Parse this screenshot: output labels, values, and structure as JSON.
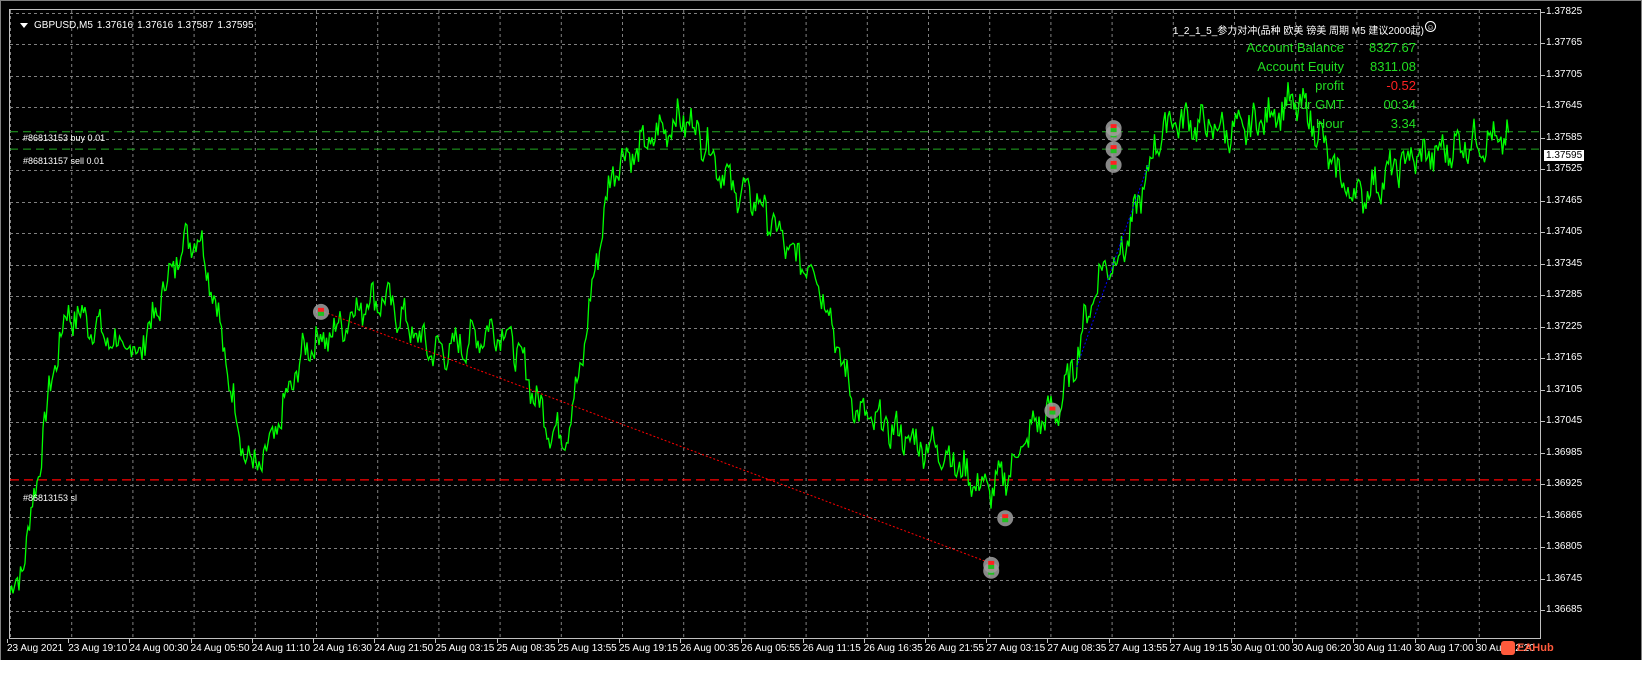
{
  "window": {
    "symbol": "GBPUSD,M5",
    "ohlc": [
      "1.37616",
      "1.37616",
      "1.37587",
      "1.37595"
    ],
    "ea_name": "1_2_1_5_参力对冲(品种 欧美 镑美 周期 M5 建议2000起)",
    "smile_glyph": "☺"
  },
  "info_panel": [
    {
      "label": "Account Balance",
      "value": "8327.67"
    },
    {
      "label": "Account Equity",
      "value": "8311.08"
    },
    {
      "label": "profit",
      "value": "-0.52"
    },
    {
      "label": "Hour GMT",
      "value": "00:34"
    },
    {
      "label": "Hour",
      "value": "3.34"
    }
  ],
  "level_labels": {
    "buy": "#86813153 buy 0.01",
    "sell": "#86813157 sell 0.01",
    "sl": "#86813153 sl"
  },
  "price_axis": {
    "current": "1.37595",
    "ticks": [
      "1.37825",
      "1.37765",
      "1.37705",
      "1.37645",
      "1.37585",
      "1.37525",
      "1.37465",
      "1.37405",
      "1.37345",
      "1.37285",
      "1.37225",
      "1.37165",
      "1.37105",
      "1.37045",
      "1.36985",
      "1.36925",
      "1.36865",
      "1.36805",
      "1.36745",
      "1.36685"
    ]
  },
  "time_axis": {
    "ticks": [
      "23 Aug 2021",
      "23 Aug 19:10",
      "24 Aug 00:30",
      "24 Aug 05:50",
      "24 Aug 11:10",
      "24 Aug 16:30",
      "24 Aug 21:50",
      "25 Aug 03:15",
      "25 Aug 08:35",
      "25 Aug 13:55",
      "25 Aug 19:15",
      "26 Aug 00:35",
      "26 Aug 05:55",
      "26 Aug 11:15",
      "26 Aug 16:35",
      "26 Aug 21:55",
      "27 Aug 03:15",
      "27 Aug 08:35",
      "27 Aug 13:55",
      "27 Aug 19:15",
      "30 Aug 01:00",
      "30 Aug 06:20",
      "30 Aug 11:40",
      "30 Aug 17:00",
      "30 Aug 22:20"
    ]
  },
  "watermark": {
    "text": "EAHub"
  },
  "colors": {
    "background": "#000000",
    "grid": "#808080",
    "price_line": "#00ff00",
    "buy_level": "#22aa22",
    "sl_level": "#ff0000",
    "info_text": "#22dd22",
    "negative": "#ff2222"
  },
  "chart_data": {
    "type": "line",
    "series": [
      {
        "x": [
          "23 Aug 2021",
          "23 Aug 19:10",
          "24 Aug 00:30",
          "24 Aug 05:50",
          "24 Aug 11:10",
          "24 Aug 16:30",
          "24 Aug 21:50",
          "25 Aug 03:15",
          "25 Aug 08:35",
          "25 Aug 13:55",
          "25 Aug 19:15",
          "26 Aug 00:35",
          "26 Aug 05:55",
          "26 Aug 11:15",
          "26 Aug 16:35",
          "26 Aug 21:55",
          "27 Aug 03:15",
          "27 Aug 08:35",
          "27 Aug 13:55",
          "27 Aug 19:15",
          "30 Aug 01:00",
          "30 Aug 06:20",
          "30 Aug 11:40",
          "30 Aug 17:00",
          "30 Aug 22:20"
        ],
        "y": [
          1.3672,
          1.3725,
          1.3718,
          1.374,
          1.3696,
          1.372,
          1.3728,
          1.3718,
          1.3722,
          1.3702,
          1.3755,
          1.3762,
          1.3748,
          1.3735,
          1.3705,
          1.37,
          1.3692,
          1.3706,
          1.3735,
          1.3762,
          1.376,
          1.3765,
          1.3748,
          1.3755,
          1.3758
        ]
      }
    ],
    "ylim": [
      1.3663,
      1.3783
    ],
    "grid": true,
    "levels": {
      "buy": 1.37598,
      "sell": 1.37565,
      "sl": 1.36935
    },
    "trade_markers": [
      {
        "x": "24 Aug 16:30",
        "y": 1.37255
      },
      {
        "x": "27 Aug 03:15",
        "y": 1.36762
      },
      {
        "x": "27 Aug 03:15",
        "y": 1.36773
      },
      {
        "x": "27 Aug 03:15",
        "y": 1.36862
      },
      {
        "x": "27 Aug 08:35",
        "y": 1.37067
      },
      {
        "x": "27 Aug 13:55",
        "y": 1.37595
      },
      {
        "x": "27 Aug 13:55",
        "y": 1.37605
      },
      {
        "x": "27 Aug 13:55",
        "y": 1.37565
      },
      {
        "x": "27 Aug 13:55",
        "y": 1.37535
      }
    ],
    "trade_lines": [
      {
        "from": [
          5,
          1.37255
        ],
        "to": [
          16,
          1.36773
        ],
        "color": "#ff0000"
      },
      {
        "from": [
          17.3,
          1.3715
        ],
        "to": [
          18.5,
          1.37535
        ],
        "color": "#0000ff"
      }
    ]
  }
}
